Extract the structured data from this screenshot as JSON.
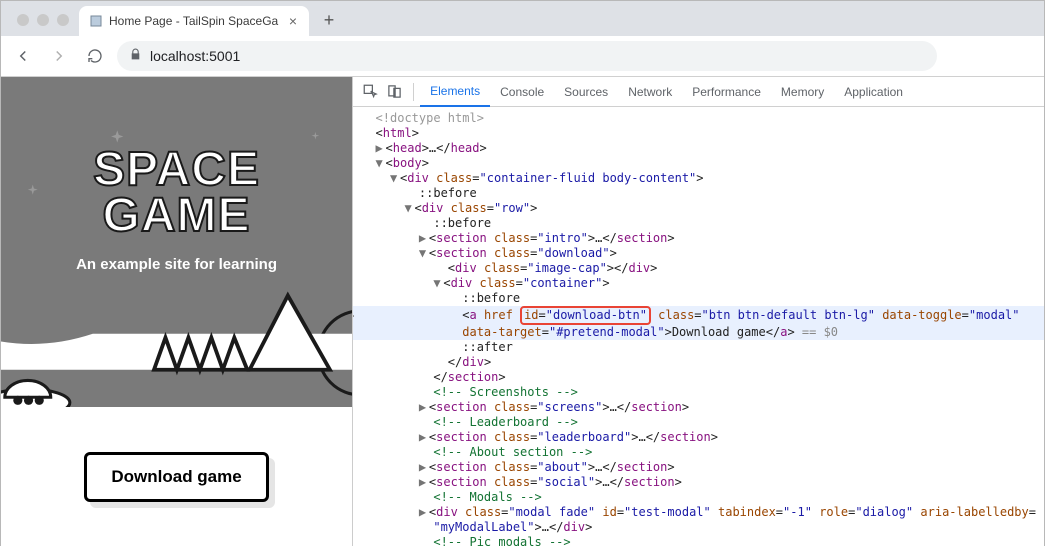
{
  "browser": {
    "tab_title": "Home Page - TailSpin SpaceGa",
    "address": "localhost:5001"
  },
  "site": {
    "title_line1": "SPACE",
    "title_line2": "GAME",
    "subtitle": "An example site for learning",
    "download_label": "Download game"
  },
  "devtools": {
    "tabs": [
      "Elements",
      "Console",
      "Sources",
      "Network",
      "Performance",
      "Memory",
      "Application"
    ],
    "active_tab": "Elements",
    "html": {
      "doctype": "<!doctype html>",
      "root": "html",
      "head_open": "head",
      "head_close": "head",
      "body_open": "body",
      "div1_class": "container-fluid body-content",
      "before": "::before",
      "row_class": "row",
      "intro_class": "intro",
      "download_class": "download",
      "imagecap_class": "image-cap",
      "container_class": "container",
      "anchor": {
        "tag": "a",
        "href": "",
        "id_attr": "id",
        "id_val": "download-btn",
        "class_val": "btn btn-default btn-lg",
        "toggle_attr": "data-toggle",
        "toggle_val": "modal",
        "target_attr": "data-target",
        "target_val": "#pretend-modal",
        "text": "Download game",
        "eq0": " == $0"
      },
      "after": "::after",
      "cmt_screens": " Screenshots ",
      "screens_class": "screens",
      "cmt_leader": " Leaderboard ",
      "leader_class": "leaderboard",
      "cmt_about": " About section ",
      "about_class": "about",
      "social_class": "social",
      "cmt_modals": " Modals ",
      "modal": {
        "class": "modal fade",
        "id": "test-modal",
        "tabindex": "-1",
        "role": "dialog",
        "aria_attr": "aria-labelledby",
        "aria_val": "myModalLabel"
      },
      "cmt_pic": " Pic modals "
    }
  }
}
